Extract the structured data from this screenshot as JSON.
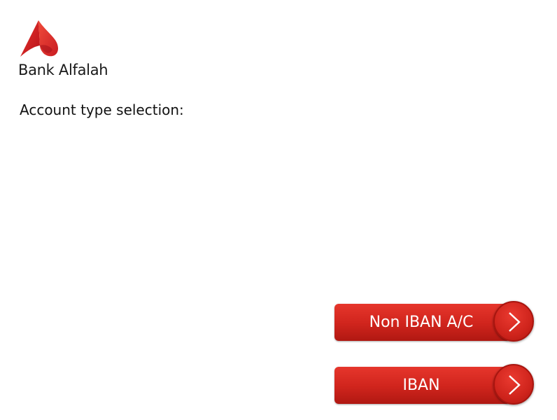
{
  "brand": {
    "name": "Bank Alfalah",
    "logo_color": "#d8232a"
  },
  "screen": {
    "title": "Account type selection:"
  },
  "options": [
    {
      "label": "Non IBAN A/C",
      "icon": "chevron-right-icon"
    },
    {
      "label": "IBAN",
      "icon": "chevron-right-icon"
    }
  ],
  "colors": {
    "button_red": "#d1251d",
    "button_text": "#ffffff",
    "background": "#ffffff"
  }
}
